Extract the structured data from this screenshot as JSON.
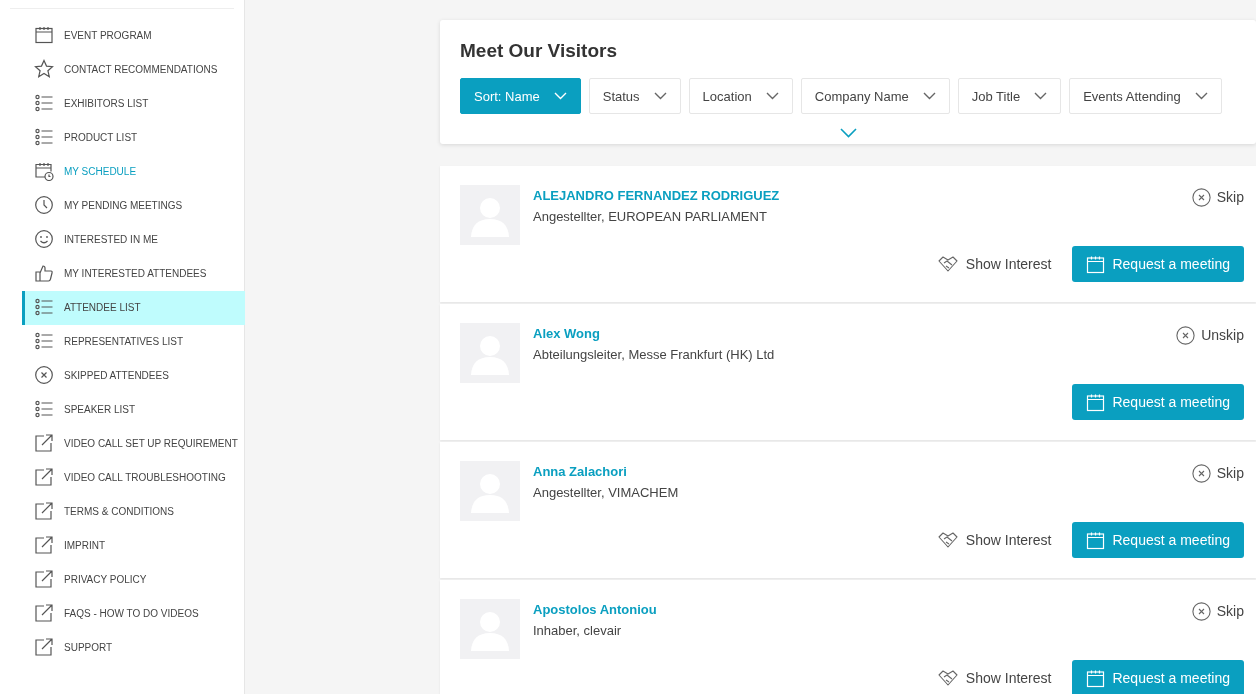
{
  "sidebar": {
    "items": [
      {
        "label": "EVENT PROGRAM",
        "kind": "calendar",
        "selected": false,
        "highlighted": false
      },
      {
        "label": "CONTACT RECOMMENDATIONS",
        "kind": "star",
        "selected": false,
        "highlighted": false
      },
      {
        "label": "EXHIBITORS LIST",
        "kind": "list",
        "selected": false,
        "highlighted": false
      },
      {
        "label": "PRODUCT LIST",
        "kind": "list",
        "selected": false,
        "highlighted": false
      },
      {
        "label": "MY SCHEDULE",
        "kind": "schedule",
        "selected": false,
        "highlighted": true
      },
      {
        "label": "MY PENDING MEETINGS",
        "kind": "clock",
        "selected": false,
        "highlighted": false
      },
      {
        "label": "INTERESTED IN ME",
        "kind": "smiley",
        "selected": false,
        "highlighted": false
      },
      {
        "label": "MY INTERESTED ATTENDEES",
        "kind": "thumb",
        "selected": false,
        "highlighted": false
      },
      {
        "label": "ATTENDEE LIST",
        "kind": "list",
        "selected": true,
        "highlighted": false
      },
      {
        "label": "REPRESENTATIVES LIST",
        "kind": "list",
        "selected": false,
        "highlighted": false
      },
      {
        "label": "SKIPPED ATTENDEES",
        "kind": "skip",
        "selected": false,
        "highlighted": false
      },
      {
        "label": "SPEAKER LIST",
        "kind": "list",
        "selected": false,
        "highlighted": false
      },
      {
        "label": "VIDEO CALL SET UP REQUIREMENT",
        "kind": "external",
        "selected": false,
        "highlighted": false
      },
      {
        "label": "VIDEO CALL TROUBLESHOOTING",
        "kind": "external",
        "selected": false,
        "highlighted": false
      },
      {
        "label": "TERMS & CONDITIONS",
        "kind": "external",
        "selected": false,
        "highlighted": false
      },
      {
        "label": "IMPRINT",
        "kind": "external",
        "selected": false,
        "highlighted": false
      },
      {
        "label": "PRIVACY POLICY",
        "kind": "external",
        "selected": false,
        "highlighted": false
      },
      {
        "label": "FAQS - HOW TO DO VIDEOS",
        "kind": "external",
        "selected": false,
        "highlighted": false
      },
      {
        "label": "SUPPORT",
        "kind": "external",
        "selected": false,
        "highlighted": false
      }
    ]
  },
  "header": {
    "title": "Meet Our Visitors",
    "filters": [
      {
        "label": "Sort: Name",
        "selected": true
      },
      {
        "label": "Status",
        "selected": false
      },
      {
        "label": "Location",
        "selected": false
      },
      {
        "label": "Company Name",
        "selected": false
      },
      {
        "label": "Job Title",
        "selected": false
      },
      {
        "label": "Events Attending",
        "selected": false
      }
    ]
  },
  "visitors": [
    {
      "name": "ALEJANDRO FERNANDEZ RODRIGUEZ",
      "subtitle": "Angestellter, EUROPEAN PARLIAMENT",
      "skip_label": "Skip",
      "show_interest_label": "Show Interest",
      "request_label": "Request a meeting"
    },
    {
      "name": "Alex Wong",
      "subtitle": "Abteilungsleiter, Messe Frankfurt (HK) Ltd",
      "skip_label": "Unskip",
      "request_label": "Request a meeting"
    },
    {
      "name": "Anna Zalachori",
      "subtitle": "Angestellter, VIMACHEM",
      "skip_label": "Skip",
      "show_interest_label": "Show Interest",
      "request_label": "Request a meeting"
    },
    {
      "name": "Apostolos Antoniou",
      "subtitle": "Inhaber, clevair",
      "skip_label": "Skip",
      "show_interest_label": "Show Interest",
      "request_label": "Request a meeting"
    }
  ]
}
